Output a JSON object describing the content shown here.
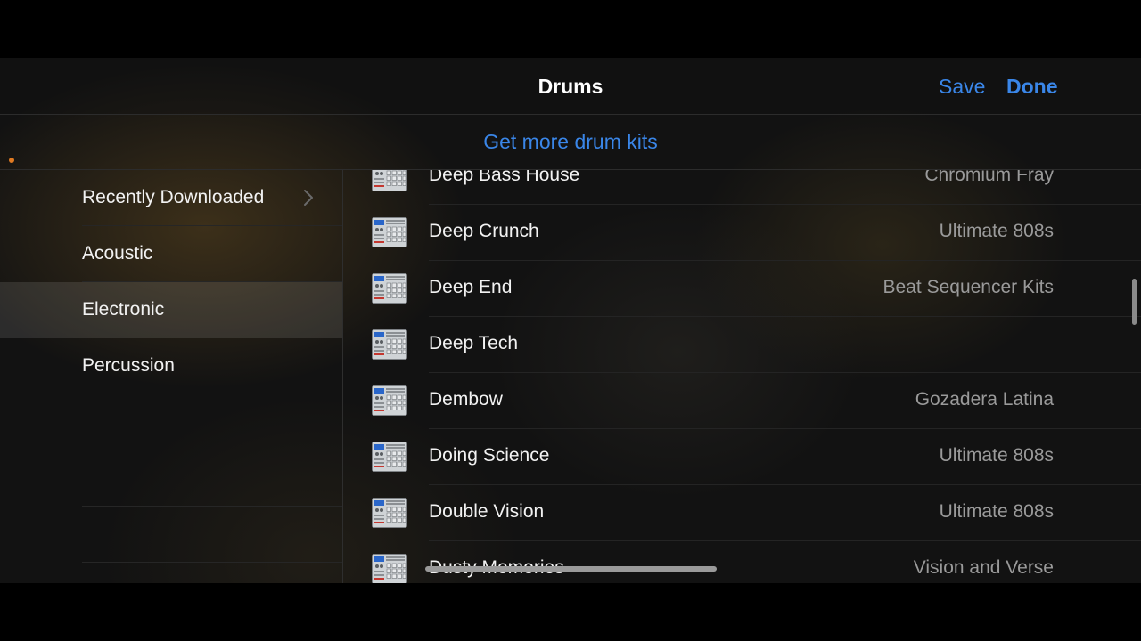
{
  "navbar": {
    "title": "Drums",
    "save_label": "Save",
    "done_label": "Done"
  },
  "more": {
    "label": "Get more drum kits"
  },
  "sidebar": {
    "items": [
      {
        "label": "Recently Downloaded",
        "has_chevron": true
      },
      {
        "label": "Acoustic"
      },
      {
        "label": "Electronic",
        "selected": true
      },
      {
        "label": "Percussion"
      }
    ]
  },
  "kits": [
    {
      "name": "Deep Bass House",
      "pack": "Chromium Fray"
    },
    {
      "name": "Deep Crunch",
      "pack": "Ultimate 808s"
    },
    {
      "name": "Deep End",
      "pack": "Beat Sequencer Kits"
    },
    {
      "name": "Deep Tech",
      "pack": ""
    },
    {
      "name": "Dembow",
      "pack": "Gozadera Latina"
    },
    {
      "name": "Doing Science",
      "pack": "Ultimate 808s"
    },
    {
      "name": "Double Vision",
      "pack": "Ultimate 808s"
    },
    {
      "name": "Dusty Memories",
      "pack": "Vision and Verse"
    }
  ],
  "icons": {
    "kit": "drum-machine-icon",
    "chevron": "chevron-right-icon"
  },
  "colors": {
    "accent": "#3a86e8",
    "status_dot": "#e07a22",
    "secondary_text": "#9a9a9a"
  }
}
